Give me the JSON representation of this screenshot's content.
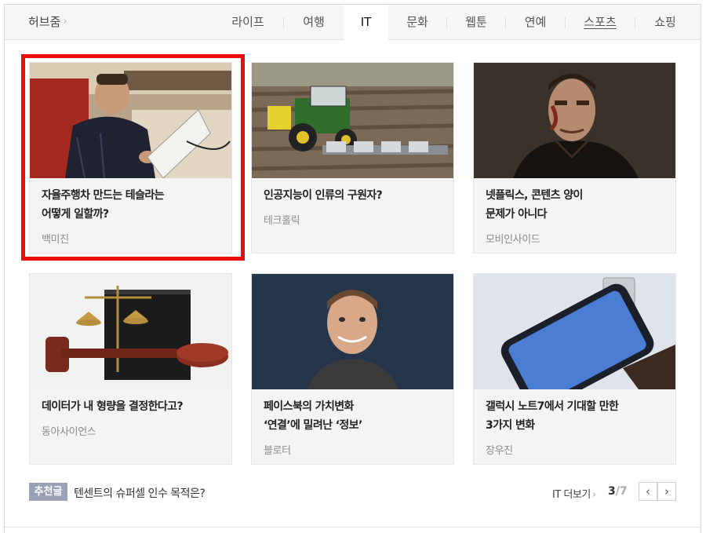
{
  "nav": {
    "hub_label": "허브줌",
    "hub_chevron": "›",
    "tabs": [
      "라이프",
      "여행",
      "IT",
      "문화",
      "웹툰",
      "연예",
      "스포츠",
      "쇼핑"
    ],
    "active_tab": "IT"
  },
  "cards": [
    {
      "title_line1": "자율주행차 만드는 테슬라는",
      "title_line2": "어떻게 일할까?",
      "source": "백미진",
      "thumb": "musk-office-photo"
    },
    {
      "title_line1": "인공지능이 인류의 구원자?",
      "title_line2": "",
      "source": "테크홀릭",
      "thumb": "tractor-field-photo"
    },
    {
      "title_line1": "넷플릭스, 콘텐츠 양이",
      "title_line2": "문제가 아니다",
      "source": "모비인사이드",
      "thumb": "punisher-poster-photo"
    },
    {
      "title_line1": "데이터가 내 형량을 결정한다고?",
      "title_line2": "",
      "source": "동아사이언스",
      "thumb": "gavel-scales-photo"
    },
    {
      "title_line1": "페이스북의 가치변화",
      "title_line2": "‘연결’에 밀려난 ‘정보’",
      "source": "블로터",
      "thumb": "zuckerberg-portrait-photo"
    },
    {
      "title_line1": "갤럭시 노트7에서 기대할 만한",
      "title_line2": "3가지 변화",
      "source": "장우진",
      "thumb": "galaxy-phone-photo"
    }
  ],
  "footer": {
    "recommend_badge": "추천글",
    "recommend_text": "텐센트의 슈퍼셀 인수 목적은?",
    "more_label": "IT 더보기",
    "more_chevron": "›",
    "page_current": "3",
    "page_separator": "/",
    "page_total": "7",
    "prev_label": "‹",
    "next_label": "›"
  },
  "colors": {
    "highlight": "#ee0d0d",
    "badge": "#9aa1b7",
    "card_bg": "#f4f4f4",
    "nav_bg": "#f6f6f6"
  }
}
